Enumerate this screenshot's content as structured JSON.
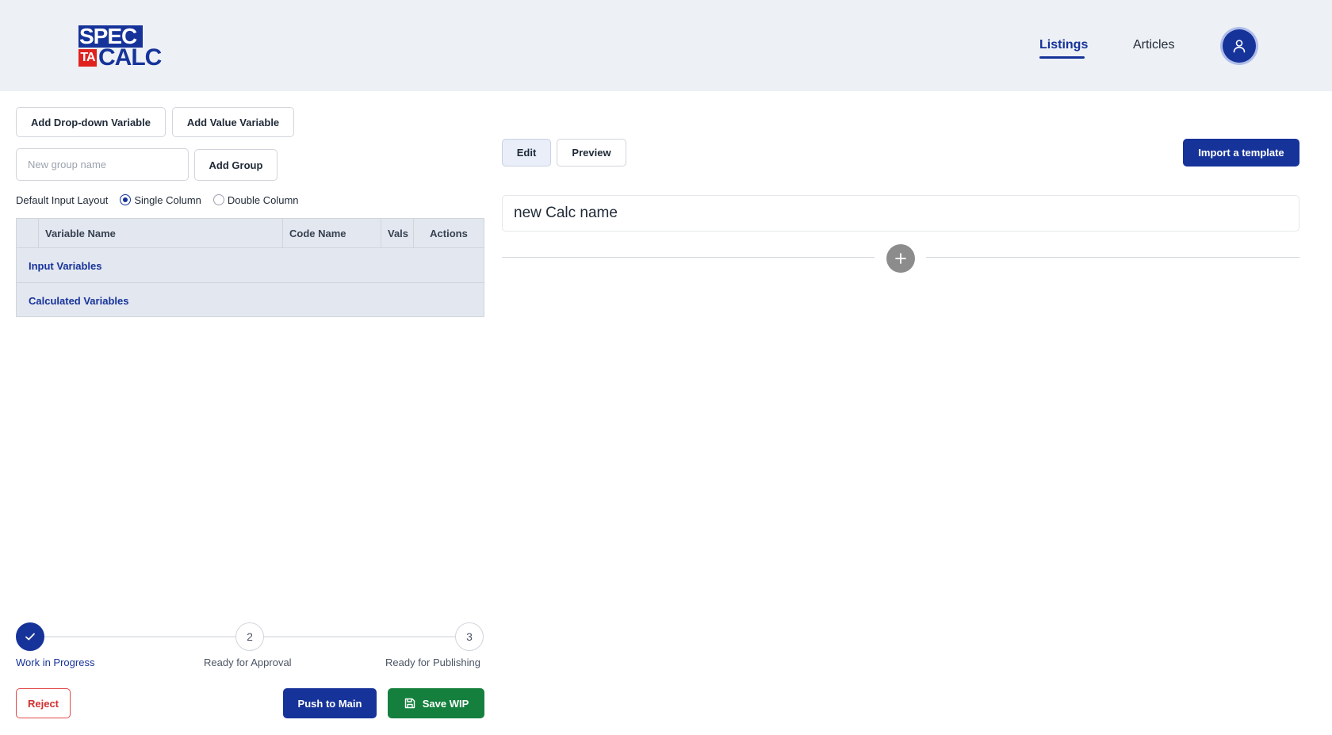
{
  "header": {
    "logo": {
      "line1": "SPEC",
      "badge": "TA",
      "line2": "CALC",
      "primary_color": "#16339a",
      "badge_color": "#e0221f"
    },
    "nav": [
      {
        "label": "Listings",
        "active": true
      },
      {
        "label": "Articles",
        "active": false
      }
    ],
    "avatar_icon": "user-icon"
  },
  "left_panel": {
    "add_dropdown_label": "Add Drop-down Variable",
    "add_value_label": "Add Value Variable",
    "group_name_placeholder": "New group name",
    "add_group_label": "Add Group",
    "layout": {
      "label": "Default Input Layout",
      "options": [
        "Single Column",
        "Double Column"
      ],
      "selected": "Single Column"
    },
    "table": {
      "columns": [
        "",
        "Variable Name",
        "Code Name",
        "Vals",
        "Actions"
      ],
      "groups": [
        "Input Variables",
        "Calculated Variables"
      ]
    }
  },
  "right_panel": {
    "edit_label": "Edit",
    "preview_label": "Preview",
    "active_mode": "Edit",
    "import_label": "Import a template",
    "calc_name": "new Calc name",
    "add_icon": "plus-icon"
  },
  "workflow": {
    "steps": [
      {
        "number": "1",
        "label": "Work in Progress",
        "status": "done"
      },
      {
        "number": "2",
        "label": "Ready for Approval",
        "status": "pending"
      },
      {
        "number": "3",
        "label": "Ready for Publishing",
        "status": "pending"
      }
    ],
    "reject_label": "Reject",
    "push_label": "Push to Main",
    "save_label": "Save WIP"
  },
  "colors": {
    "primary": "#16339a",
    "success": "#15803d",
    "danger": "#d32f2f",
    "header_bg": "#edf0f5"
  }
}
